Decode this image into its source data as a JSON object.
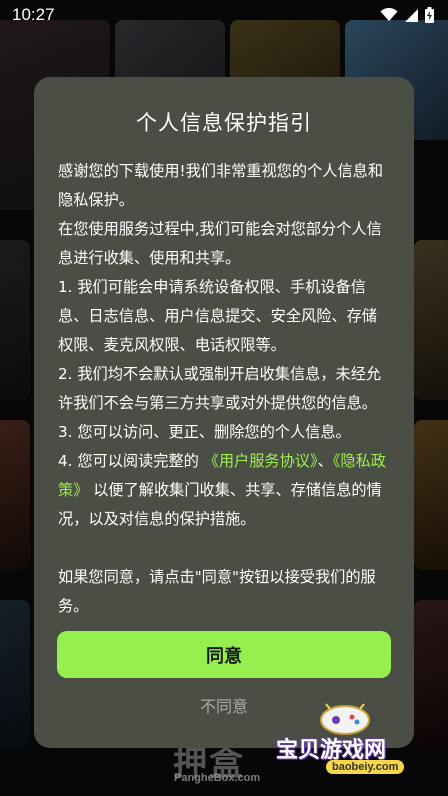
{
  "status_bar": {
    "time": "10:27",
    "icons": [
      "wifi-icon",
      "signal-icon",
      "battery-charging-icon"
    ]
  },
  "dialog": {
    "title": "个人信息保护指引",
    "intro": "感谢您的下载使用!我们非常重视您的个人信息和隐私保护。",
    "para2": "在您使用服务过程中,我们可能会对您部分个人信息进行收集、使用和共享。",
    "item1": "1. 我们可能会申请系统设备权限、手机设备信息、日志信息、用户信息提交、安全风险、存储权限、麦克风权限、电话权限等。",
    "item2": "2. 我们均不会默认或强制开启收集信息，未经允许我们不会与第三方共享或对外提供您的信息。",
    "item3": "3. 您可以访问、更正、删除您的个人信息。",
    "item4_prefix": "4. 您可以阅读完整的",
    "link_user_agreement": "《用户服务协议》",
    "item4_sep": "、",
    "link_privacy_policy": "《隐私政策》",
    "item4_suffix": "以便了解收集门收集、共享、存储信息的情况，以及对信息的保护措施。",
    "consent_note": "如果您同意，请点击\"同意\"按钮以接受我们的服务。",
    "agree_label": "同意",
    "disagree_label": "不同意",
    "colors": {
      "panel": "#4a4e44",
      "accent": "#95ef4f",
      "link": "#9eef52"
    }
  },
  "watermarks": {
    "brand": "押盒",
    "brand_sub": "PangheBox.com",
    "site_name": "宝贝游戏网",
    "site_url": "baobeiy.com"
  }
}
